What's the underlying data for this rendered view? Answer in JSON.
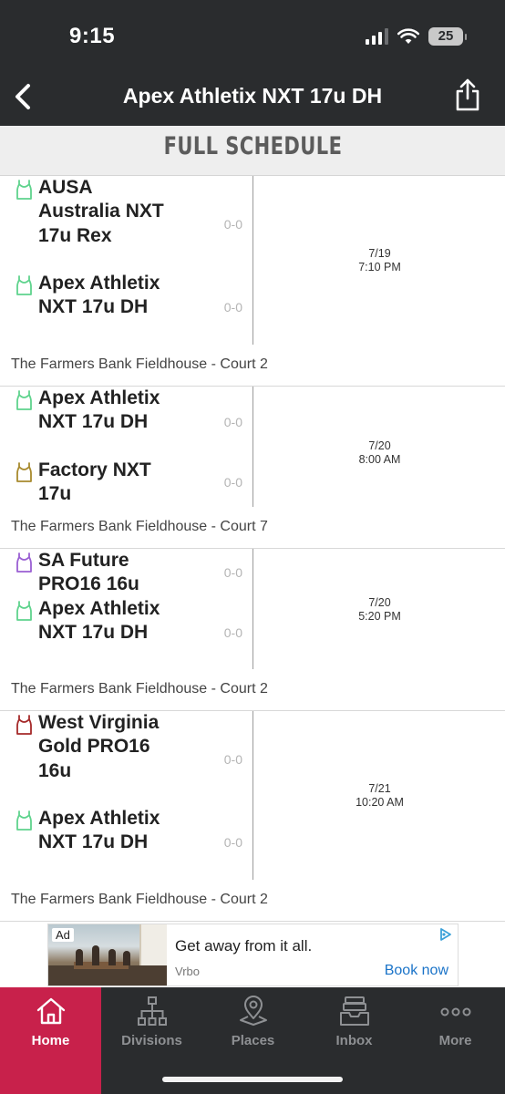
{
  "status_bar": {
    "time": "9:15",
    "battery": "25"
  },
  "nav": {
    "title": "Apex Athletix NXT 17u DH"
  },
  "section": {
    "heading": "FULL SCHEDULE"
  },
  "games": [
    {
      "teams": [
        {
          "name": "AUSA Australia NXT 17u Rex",
          "score": "0-0",
          "jersey_color": "#5fd38d"
        },
        {
          "name": "Apex Athletix NXT 17u DH",
          "score": "0-0",
          "jersey_color": "#5fd38d"
        }
      ],
      "date": "7/19",
      "time": "7:10 PM",
      "venue": "The Farmers Bank Fieldhouse - Court 2"
    },
    {
      "teams": [
        {
          "name": "Apex Athletix NXT 17u DH",
          "score": "0-0",
          "jersey_color": "#5fd38d"
        },
        {
          "name": "Factory NXT 17u",
          "score": "0-0",
          "jersey_color": "#a88a2e"
        }
      ],
      "date": "7/20",
      "time": "8:00 AM",
      "venue": "The Farmers Bank Fieldhouse - Court 7"
    },
    {
      "teams": [
        {
          "name": "SA Future PRO16 16u",
          "score": "0-0",
          "jersey_color": "#9a5fd3"
        },
        {
          "name": "Apex Athletix NXT 17u DH",
          "score": "0-0",
          "jersey_color": "#5fd38d"
        }
      ],
      "date": "7/20",
      "time": "5:20 PM",
      "venue": "The Farmers Bank Fieldhouse - Court 2"
    },
    {
      "teams": [
        {
          "name": "West Virginia Gold PRO16 16u",
          "score": "0-0",
          "jersey_color": "#a52a2a"
        },
        {
          "name": "Apex Athletix NXT 17u DH",
          "score": "0-0",
          "jersey_color": "#5fd38d"
        }
      ],
      "date": "7/21",
      "time": "10:20 AM",
      "venue": "The Farmers Bank Fieldhouse - Court 2"
    }
  ],
  "ad": {
    "label": "Ad",
    "headline": "Get away from it all.",
    "brand": "Vrbo",
    "cta": "Book now"
  },
  "tabs": [
    {
      "label": "Home",
      "icon": "home-icon",
      "active": true
    },
    {
      "label": "Divisions",
      "icon": "bracket-icon",
      "active": false
    },
    {
      "label": "Places",
      "icon": "map-pin-icon",
      "active": false
    },
    {
      "label": "Inbox",
      "icon": "inbox-icon",
      "active": false
    },
    {
      "label": "More",
      "icon": "more-dots-icon",
      "active": false
    }
  ],
  "colors": {
    "header_bg": "#2a2c2e",
    "accent": "#c8214b",
    "link": "#1a73c8"
  }
}
